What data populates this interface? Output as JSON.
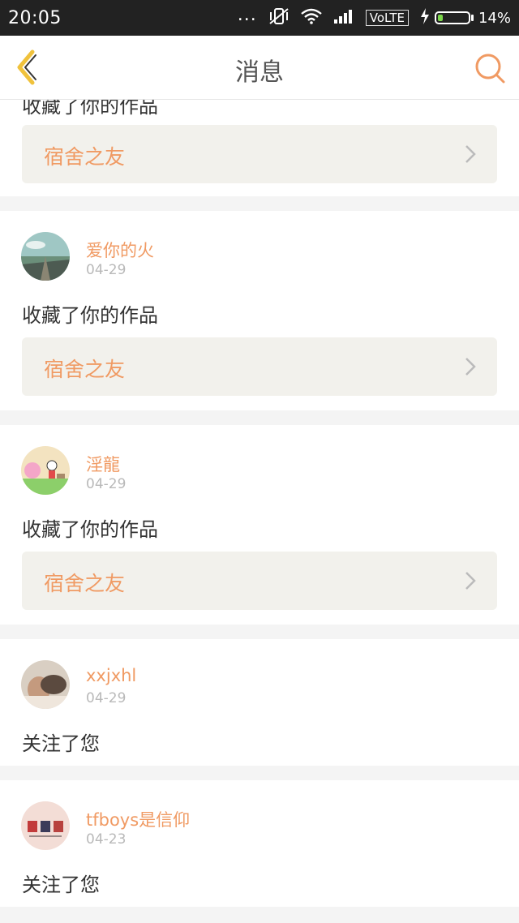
{
  "status_bar": {
    "time": "20:05",
    "dots": "...",
    "network": "VoLTE",
    "battery": "14%"
  },
  "header": {
    "title": "消息",
    "back_icon": "back-chevron-icon",
    "search_icon": "search-icon"
  },
  "colors": {
    "accent": "#f09a63",
    "back_arrow": "#f0c23c",
    "card_bg": "#ffffff",
    "work_bg": "#f2f1ec",
    "page_bg": "#f4f4f4"
  },
  "notifications": [
    {
      "action": "收藏了你的作品",
      "work": "宿舍之友"
    },
    {
      "username": "爱你的火",
      "date": "04-29",
      "action": "收藏了你的作品",
      "work": "宿舍之友"
    },
    {
      "username": "淫龍",
      "date": "04-29",
      "action": "收藏了你的作品",
      "work": "宿舍之友"
    },
    {
      "username": "xxjxhl",
      "date": "04-29",
      "action": "关注了您"
    },
    {
      "username": "tfboys是信仰",
      "date": "04-23",
      "action": "关注了您"
    }
  ]
}
